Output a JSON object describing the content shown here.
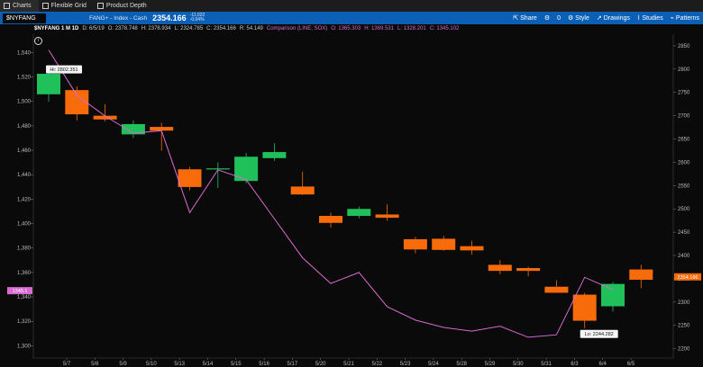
{
  "topbar": {
    "tabs": [
      {
        "label": "Charts",
        "icon": "chart-icon"
      },
      {
        "label": "Flexible Grid",
        "icon": "grid-icon"
      },
      {
        "label": "Product Depth",
        "icon": "depth-icon"
      }
    ]
  },
  "toolbar": {
    "symbol": "$NYFANG",
    "description": "FANG+ - Index - Cash",
    "last_price": "2354.166",
    "change": "-11.022",
    "change_pct": "-0.04%",
    "buttons": [
      "Share",
      "0",
      "Style",
      "Drawings",
      "Studies",
      "Patterns"
    ]
  },
  "infobar": {
    "symbol_period": "$NYFANG 1 M 1D",
    "date": "D: 6/5/19",
    "open": "O: 2378.748",
    "high": "H: 2378.934",
    "low": "L: 2324.785",
    "close": "C: 2354.166",
    "range": "R: 54.149",
    "comparison": "Comparison (LINE, SOX)",
    "comp_open": "O: 1365.303",
    "comp_high": "H: 1369.531",
    "comp_low": "L: 1328.201",
    "comp_close": "C: 1345.102"
  },
  "colors": {
    "up": "#20c05a",
    "down": "#f76b0a",
    "comparison_line": "#d86ad0",
    "background": "#0a0a0a",
    "toolbar": "#0b5fb5"
  },
  "chart_data": {
    "type": "candlestick",
    "comparison_series": "SOX",
    "left_axis": {
      "ticks": [
        1300,
        1320,
        1340,
        1360,
        1380,
        1400,
        1420,
        1440,
        1460,
        1480,
        1500,
        1520,
        1540
      ],
      "range": [
        1290,
        1555
      ]
    },
    "right_axis": {
      "ticks": [
        2200,
        2250,
        2300,
        2350,
        2400,
        2450,
        2500,
        2550,
        2600,
        2650,
        2700,
        2750,
        2800,
        2850
      ],
      "range": [
        2180,
        2875
      ]
    },
    "x": [
      "5/7",
      "5/8",
      "5/9",
      "5/10",
      "5/13",
      "5/14",
      "5/15",
      "5/16",
      "5/17",
      "5/20",
      "5/21",
      "5/22",
      "5/23",
      "5/24",
      "5/28",
      "5/29",
      "5/30",
      "5/31",
      "6/3",
      "6/4",
      "6/5"
    ],
    "ohlc": [
      {
        "o": 2746,
        "h": 2802.351,
        "l": 2730,
        "c": 2790
      },
      {
        "o": 2755,
        "h": 2763,
        "l": 2690,
        "c": 2703
      },
      {
        "o": 2700,
        "h": 2725,
        "l": 2688,
        "c": 2692
      },
      {
        "o": 2660,
        "h": 2690,
        "l": 2652,
        "c": 2682
      },
      {
        "o": 2676,
        "h": 2685,
        "l": 2625,
        "c": 2668
      },
      {
        "o": 2585,
        "h": 2590,
        "l": 2540,
        "c": 2547
      },
      {
        "o": 2587,
        "h": 2600,
        "l": 2545,
        "c": 2587
      },
      {
        "o": 2560,
        "h": 2620,
        "l": 2555,
        "c": 2612
      },
      {
        "o": 2609,
        "h": 2641,
        "l": 2603,
        "c": 2622
      },
      {
        "o": 2548,
        "h": 2580,
        "l": 2530,
        "c": 2531
      },
      {
        "o": 2485,
        "h": 2492,
        "l": 2460,
        "c": 2470
      },
      {
        "o": 2485,
        "h": 2505,
        "l": 2480,
        "c": 2500
      },
      {
        "o": 2488,
        "h": 2510,
        "l": 2475,
        "c": 2481
      },
      {
        "o": 2435,
        "h": 2440,
        "l": 2405,
        "c": 2413
      },
      {
        "o": 2436,
        "h": 2442,
        "l": 2410,
        "c": 2412
      },
      {
        "o": 2420,
        "h": 2432,
        "l": 2402,
        "c": 2411
      },
      {
        "o": 2380,
        "h": 2390,
        "l": 2360,
        "c": 2367
      },
      {
        "o": 2373,
        "h": 2376,
        "l": 2355,
        "c": 2367
      },
      {
        "o": 2333,
        "h": 2347,
        "l": 2325,
        "c": 2320
      },
      {
        "o": 2316,
        "h": 2320,
        "l": 2244.282,
        "c": 2260
      },
      {
        "o": 2291,
        "h": 2343,
        "l": 2280,
        "c": 2339
      },
      {
        "o": 2370,
        "h": 2380,
        "l": 2330,
        "c": 2348
      }
    ],
    "comparison_values": [
      1542,
      1505,
      1488,
      1474,
      1476,
      1409,
      1444,
      1436,
      1404,
      1372,
      1351,
      1360,
      1332,
      1321,
      1315,
      1312,
      1316,
      1307,
      1309,
      1356,
      1346
    ],
    "annotations": {
      "high_label": "Hi: 2802.351",
      "low_label": "Lo: 2244.282"
    },
    "last_price_right": "2354.166",
    "last_price_left": "1345.1"
  }
}
